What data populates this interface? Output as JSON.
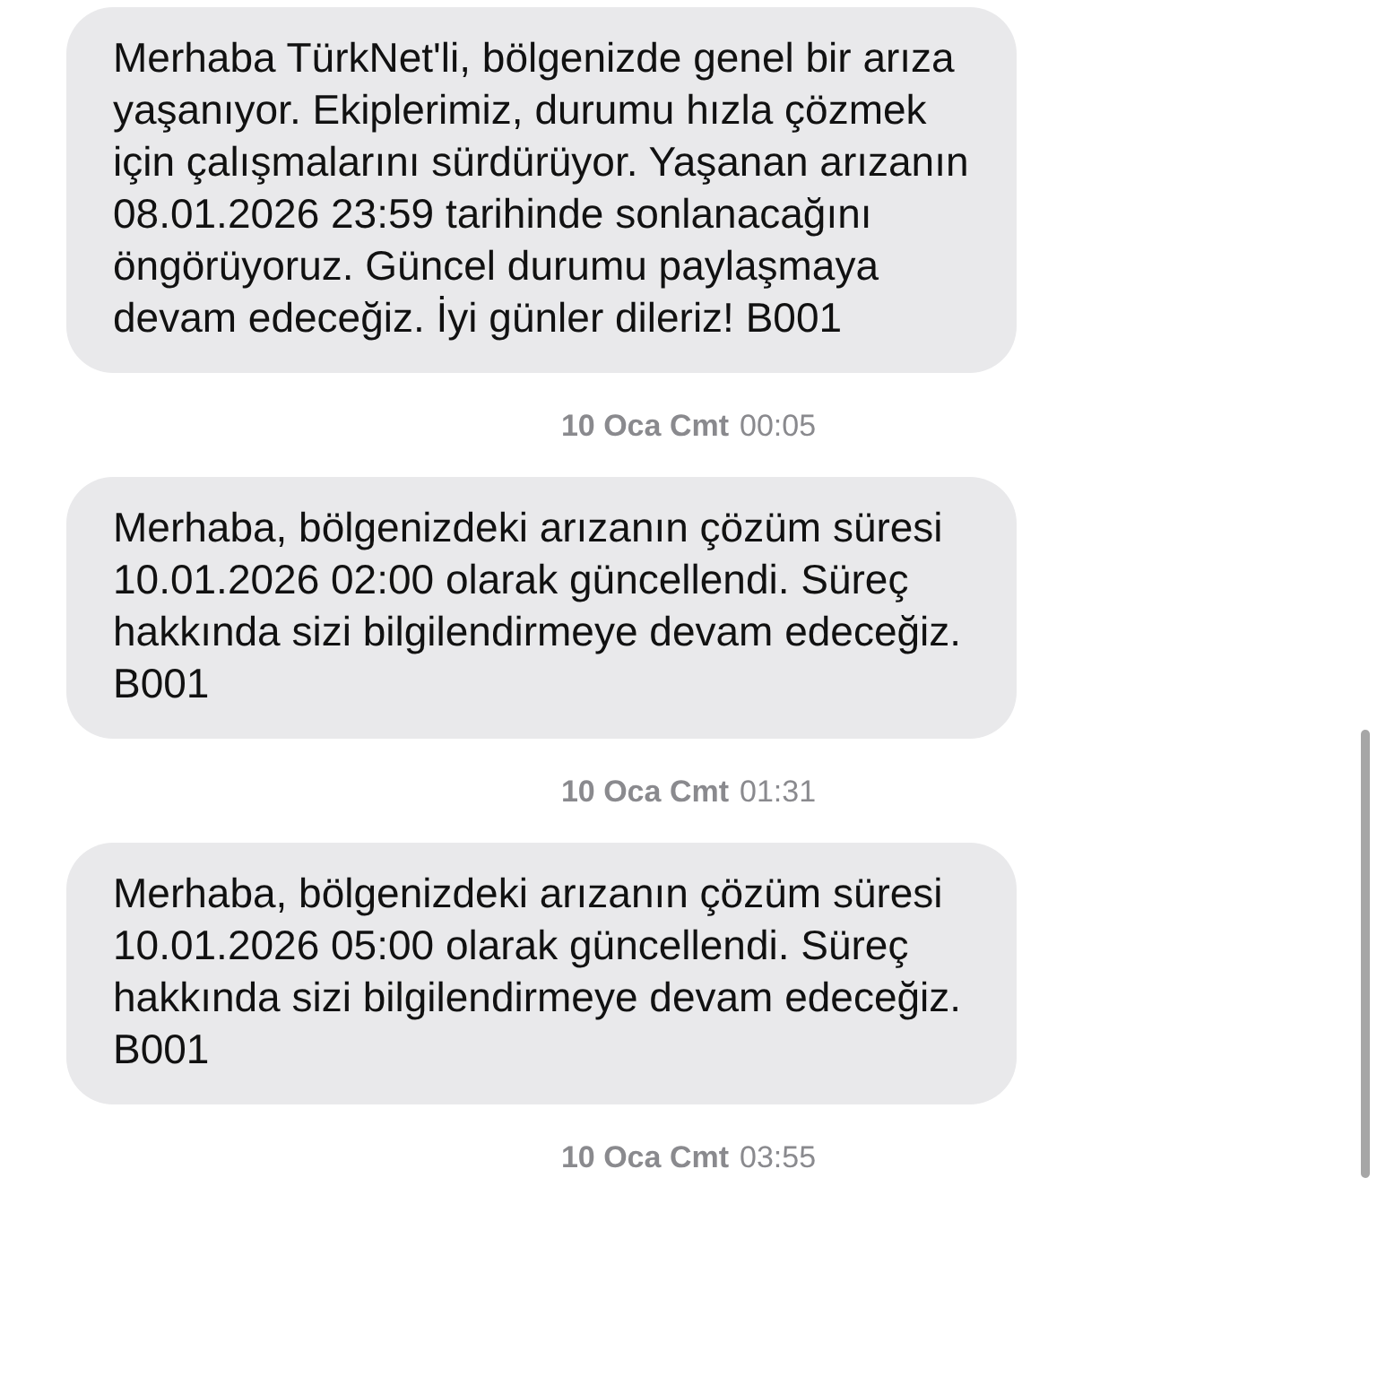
{
  "messages": [
    {
      "text": "Merhaba TürkNet'li, bölgenizde genel bir arıza yaşanıyor. Ekiplerimiz, durumu hızla çözmek için çalışmalarını sürdürüyor. Yaşanan arızanın 08.01.2026 23:59 tarihinde sonlanacağını öngörüyoruz. Güncel durumu paylaşmaya devam edeceğiz. İyi günler dileriz! B001",
      "date": "10 Oca Cmt",
      "time": "00:05"
    },
    {
      "text": "Merhaba, bölgenizdeki arızanın çözüm süresi 10.01.2026 02:00 olarak güncellendi. Süreç hakkında sizi bilgilendirmeye devam edeceğiz. B001",
      "date": "10 Oca Cmt",
      "time": "01:31"
    },
    {
      "text": "Merhaba, bölgenizdeki arızanın çözüm süresi 10.01.2026 05:00 olarak güncellendi. Süreç hakkında sizi bilgilendirmeye devam edeceğiz. B001",
      "date": "10 Oca Cmt",
      "time": "03:55"
    }
  ]
}
